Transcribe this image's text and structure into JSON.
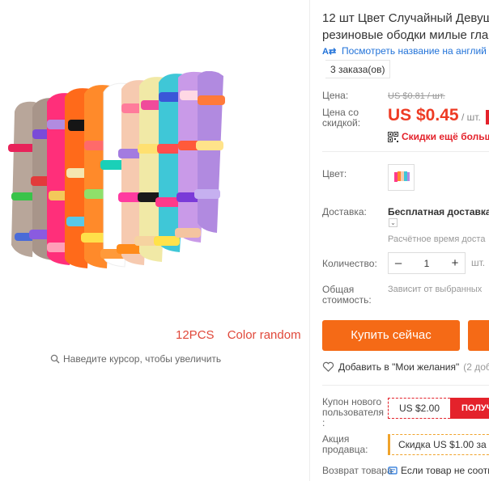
{
  "gallery": {
    "caption_count": "12PCS",
    "caption_color": "Color random",
    "zoom_hint": "Наведите курсор, чтобы увеличить"
  },
  "product": {
    "title_line1": "12 шт Цвет Случайный Девушк",
    "title_line2": "резиновые ободки милые глав",
    "translate_link": "Посмотреть название на англий",
    "orders": "3 заказа(ов)"
  },
  "price": {
    "label": "Цена:",
    "old_price": "US $0.81 / шт.",
    "discount_label": "Цена со скидкой:",
    "new_price": "US $0.45",
    "unit": "/ шт.",
    "promo_text": "Скидки ещё больше"
  },
  "options": {
    "color_label": "Цвет:",
    "shipping_label": "Доставка:",
    "shipping_value": "Бесплатная доставка",
    "shipping_estimate": "Расчётное время доста",
    "quantity_label": "Количество:",
    "quantity_value": "1",
    "quantity_minus": "–",
    "quantity_plus": "+",
    "quantity_unit": "шт.",
    "total_label": "Общая стоимость:",
    "total_value": "Зависит от выбранных"
  },
  "actions": {
    "buy_now": "Купить сейчас",
    "wishlist": "Добавить в \"Мои желания\"",
    "wishlist_count": "(2 доба"
  },
  "coupons": {
    "new_user_label": "Купон нового пользователя :",
    "new_user_amount": "US $2.00",
    "new_user_get": "ПОЛУЧ",
    "seller_label": "Акция продавца:",
    "seller_promo": "Скидка US $1.00 за ка",
    "return_label": "Возврат товара",
    "return_value": "Если товар не соотве"
  },
  "colors": {
    "accent_price": "#ee3b24",
    "buy_button": "#f56a16",
    "link": "#2273d9",
    "caption": "#e0483a"
  }
}
